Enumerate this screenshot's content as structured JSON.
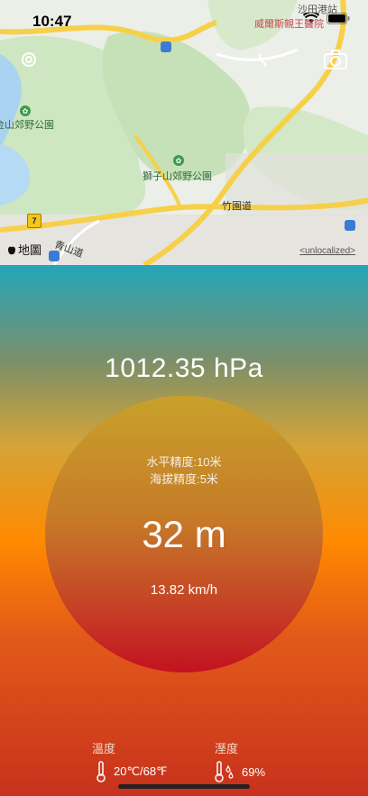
{
  "status_bar": {
    "time": "10:47"
  },
  "map": {
    "labels": {
      "hospital": "威爾斯親王醫院",
      "top_right": "沙田港站",
      "park_left": "金山郊野公園",
      "park_center": "獅子山郊野公園",
      "road_1": "竹園道",
      "road_2": "青山道",
      "route_shield": "7"
    },
    "maps_logo": "地圖",
    "legal_link": "<unlocalized>"
  },
  "pressure": "1012.35 hPa",
  "accuracy": {
    "horizontal": "水平精度:10米",
    "altitude": "海拔精度:5米"
  },
  "altitude": "32 m",
  "speed": "13.82 km/h",
  "stats": {
    "temperature_label": "溫度",
    "temperature_value": "20℃/68℉",
    "humidity_label": "溼度",
    "humidity_value": "69%"
  },
  "colors": {
    "top": "#24a6ba",
    "middle": "#ff8a00",
    "bottom": "#c8311d",
    "circle_bottom": "#c2121f"
  }
}
